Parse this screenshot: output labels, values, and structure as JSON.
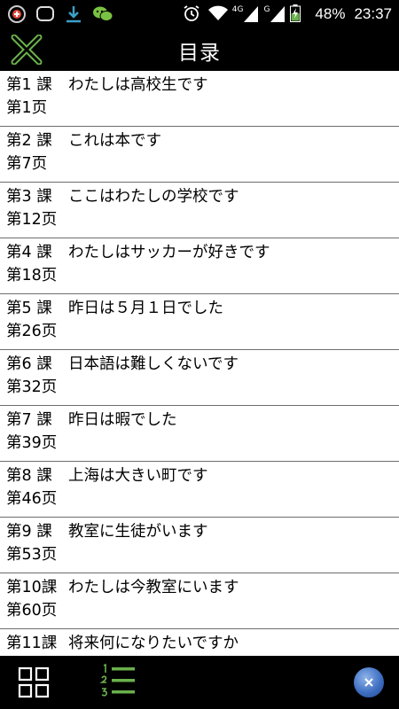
{
  "status_bar": {
    "icons": [
      "vpn-add-icon",
      "message-bubble-icon",
      "download-icon",
      "wechat-icon",
      "alarm-icon",
      "wifi-icon",
      "signal-4g-icon",
      "signal-g-icon",
      "battery-charging-icon"
    ],
    "network_4g": "4G",
    "network_g": "G",
    "battery": "48%",
    "time": "23:37"
  },
  "header": {
    "title": "目录",
    "close_icon": "close-x-icon",
    "accent_color": "#6ab04c"
  },
  "lessons": [
    {
      "number": "第1 課",
      "title": "わたしは高校生です",
      "page": "第1页"
    },
    {
      "number": "第2 課",
      "title": "これは本です",
      "page": "第7页"
    },
    {
      "number": "第3 課",
      "title": "ここはわたしの学校です",
      "page": "第12页"
    },
    {
      "number": "第4 課",
      "title": "わたしはサッカーが好きです",
      "page": "第18页"
    },
    {
      "number": "第5 課",
      "title": "昨日は５月１日でした",
      "page": "第26页"
    },
    {
      "number": "第6 課",
      "title": "日本語は難しくないです",
      "page": "第32页"
    },
    {
      "number": "第7 課",
      "title": "昨日は暇でした",
      "page": "第39页"
    },
    {
      "number": "第8 課",
      "title": "上海は大きい町です",
      "page": "第46页"
    },
    {
      "number": "第9 課",
      "title": "教室に生徒がいます",
      "page": "第53页"
    },
    {
      "number": "第10課",
      "title": "わたしは今教室にいます",
      "page": "第60页"
    },
    {
      "number": "第11課",
      "title": "将来何になりたいですか",
      "page": ""
    }
  ],
  "bottom_bar": {
    "grid_icon": "grid-view-icon",
    "list_icon": "numbered-list-icon",
    "float_icon": "floating-assistant-icon"
  }
}
